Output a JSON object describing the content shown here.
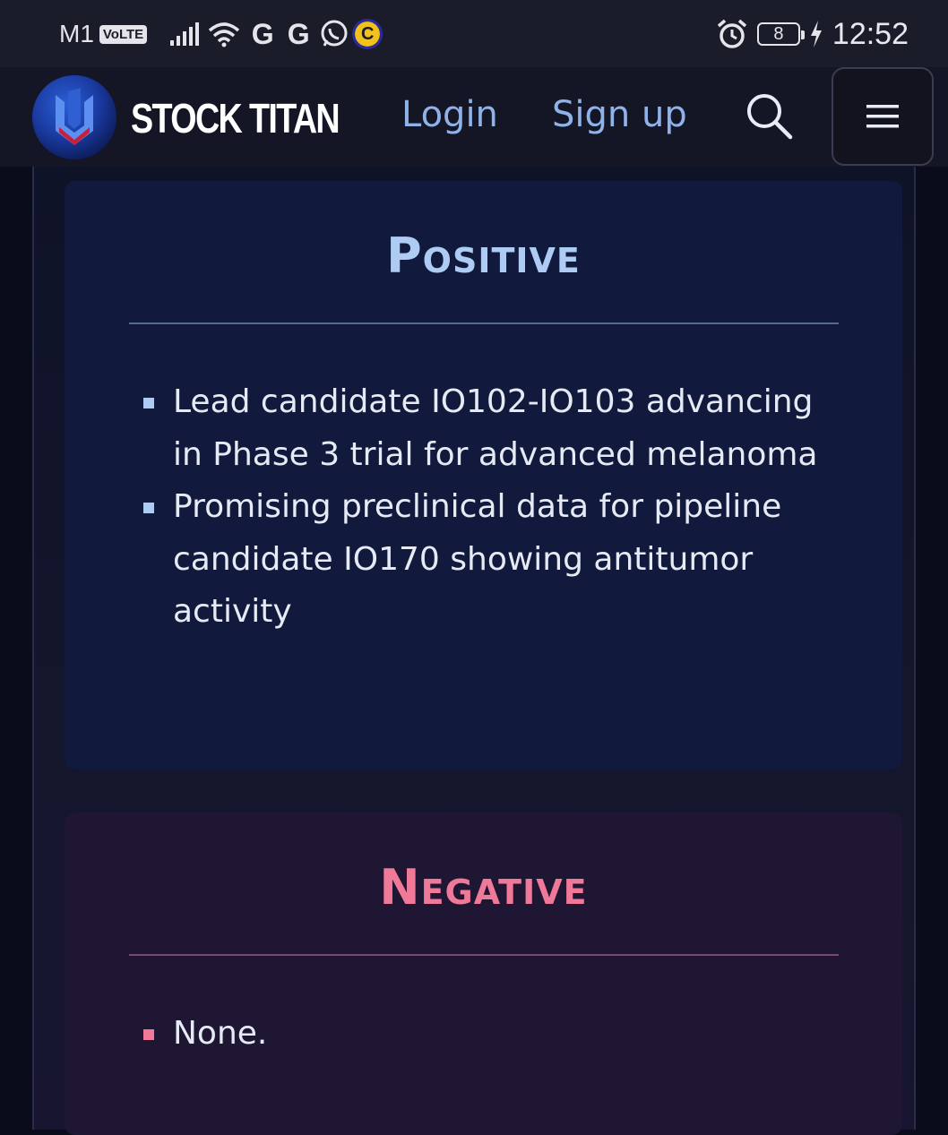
{
  "status_bar": {
    "carrier": "M1",
    "volte": "VoLTE",
    "battery_level": "8",
    "time": "12:52",
    "icons": [
      "signal-icon",
      "wifi-icon",
      "google-icon",
      "google-icon",
      "whatsapp-icon",
      "coin-app-icon",
      "alarm-icon",
      "battery-icon",
      "charging-icon"
    ]
  },
  "header": {
    "brand": "STOCK TITAN",
    "login": "Login",
    "signup": "Sign up",
    "search_icon": "search-icon",
    "menu_icon": "hamburger-menu-icon"
  },
  "positive": {
    "title": "Positive",
    "accent": "#aecbf4",
    "items": [
      "Lead candidate IO102-IO103 advancing in Phase 3 trial for advanced melanoma",
      "Promising preclinical data for pipeline candidate IO170 showing antitumor activity"
    ]
  },
  "negative": {
    "title": "Negative",
    "accent": "#f07898",
    "items": [
      "None."
    ]
  }
}
